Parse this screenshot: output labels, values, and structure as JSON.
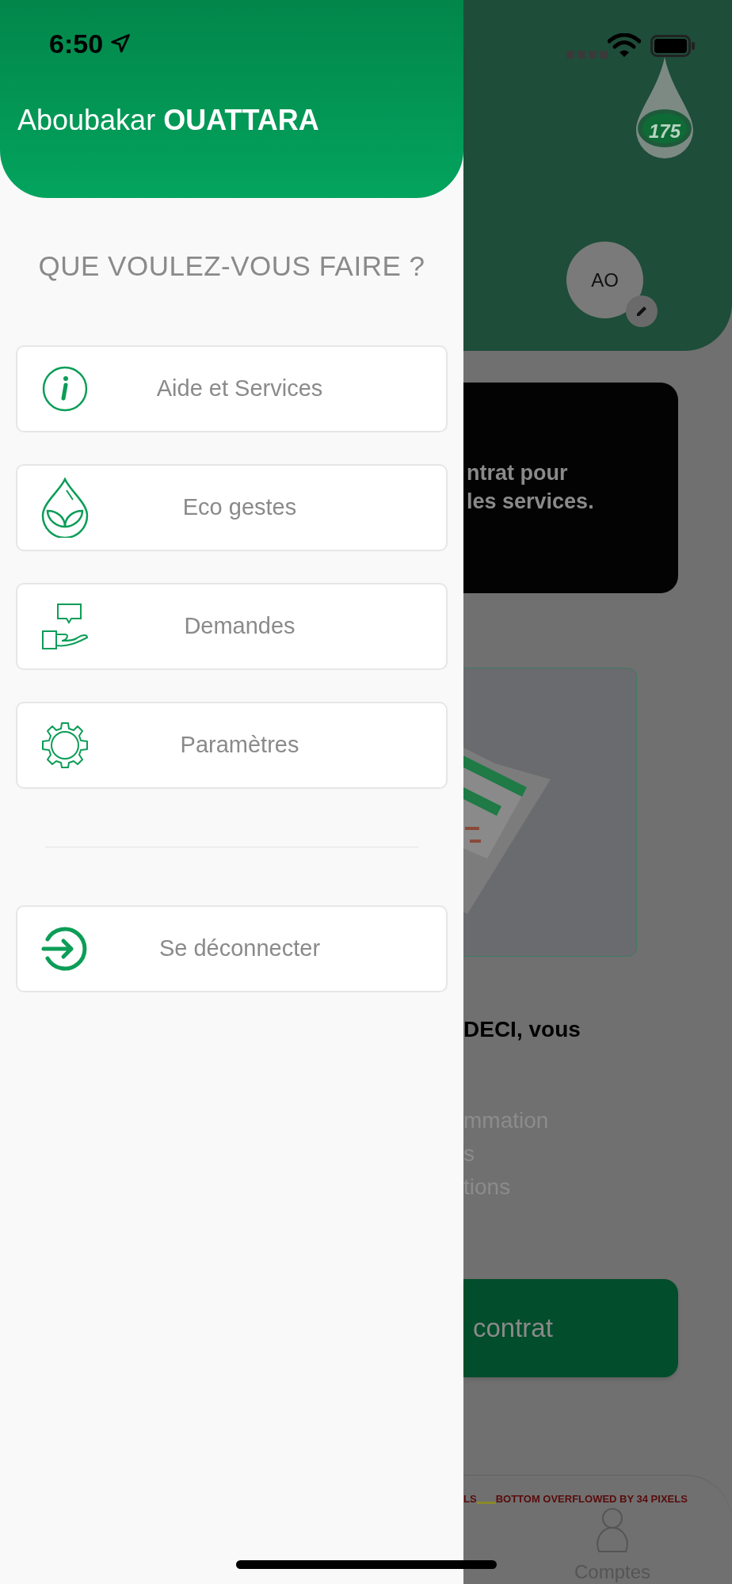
{
  "status_bar": {
    "time": "6:50"
  },
  "drawer": {
    "name": "Aboubakar **OUATTARA**",
    "heading": "QUE VOULEZ-VOUS FAIRE ?",
    "items": [
      {
        "kind": "info",
        "label": "Aide et Services"
      },
      {
        "kind": "eco",
        "label": "Eco gestes"
      },
      {
        "kind": "request",
        "label": "Demandes"
      },
      {
        "kind": "settings",
        "label": "Paramètres"
      }
    ],
    "logout": {
      "kind": "logout",
      "label": "Se déconnecter"
    }
  },
  "background": {
    "logo_badge": "175",
    "avatar": {
      "initials": "AO"
    },
    "notice_card": {
      "lines": [
        "ntrat pour",
        "les services."
      ]
    },
    "intro": "DECI, vous",
    "features": [
      "mmation",
      "s",
      "tions"
    ],
    "action_button": "contrat",
    "overflow_warning": [
      "LS",
      "BOTTOM OVERFLOWED BY 34 PIXELS"
    ],
    "nav": [
      {
        "label": "Comptes"
      }
    ]
  }
}
